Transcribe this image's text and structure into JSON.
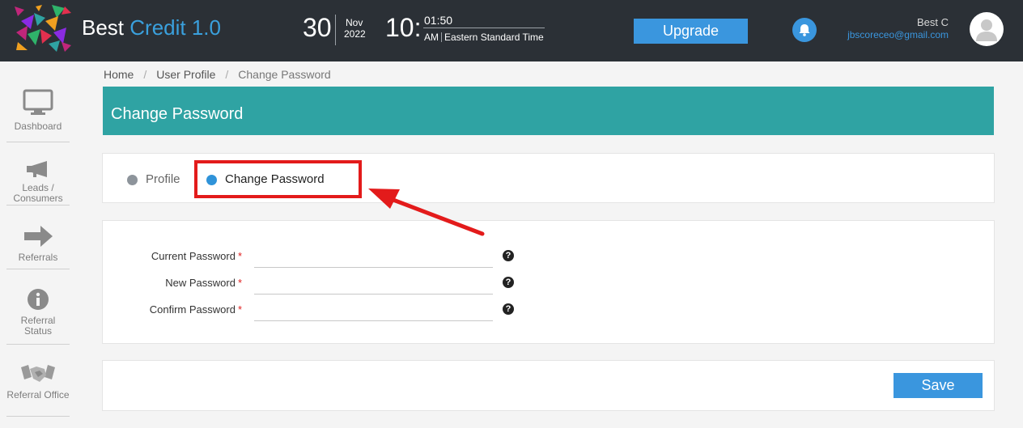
{
  "app": {
    "brand_primary": "Best",
    "brand_accent": "Credit 1.0",
    "accent_color": "#3aa0dd"
  },
  "header": {
    "day": "30",
    "month": "Nov",
    "year": "2022",
    "hour": "10:",
    "minute": "01:50",
    "ampm": "AM",
    "timezone": "Eastern Standard Time",
    "upgrade_label": "Upgrade",
    "user_name": "Best C",
    "user_email": "jbscoreceo@gmail.com"
  },
  "sidebar": {
    "items": [
      {
        "label": "Dashboard",
        "icon": "monitor-icon"
      },
      {
        "label": "Leads / Consumers",
        "icon": "megaphone-icon"
      },
      {
        "label": "Referrals",
        "icon": "arrow-right-icon"
      },
      {
        "label": "Referral Status",
        "icon": "info-icon"
      },
      {
        "label": "Referral Office",
        "icon": "handshake-icon"
      }
    ]
  },
  "breadcrumb": [
    "Home",
    "User Profile",
    "Change Password"
  ],
  "page": {
    "title": "Change Password"
  },
  "tabs": [
    {
      "label": "Profile",
      "active": false
    },
    {
      "label": "Change Password",
      "active": true
    }
  ],
  "form": {
    "fields": [
      {
        "label": "Current Password",
        "required_mark": "*",
        "value": ""
      },
      {
        "label": "New Password",
        "required_mark": "*",
        "value": ""
      },
      {
        "label": "Confirm Password",
        "required_mark": "*",
        "value": ""
      }
    ],
    "help_glyph": "?",
    "save_label": "Save"
  },
  "colors": {
    "topbar": "#2b3036",
    "header_panel": "#2fa3a3",
    "button": "#3a96de",
    "highlight": "#e31b1b"
  }
}
